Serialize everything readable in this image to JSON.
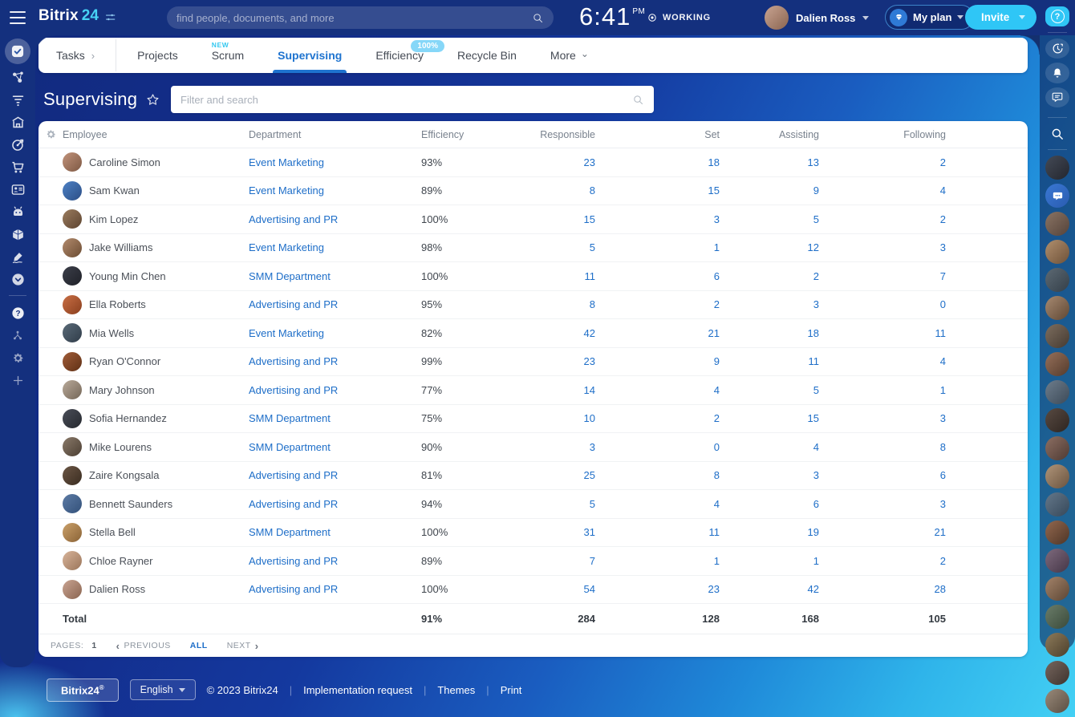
{
  "topbar": {
    "logo": {
      "brand": "Bitrix",
      "suffix": "24"
    },
    "search_placeholder": "find people, documents, and more",
    "time": {
      "value": "6:41",
      "meridiem": "PM"
    },
    "status_label": "WORKING",
    "user_name": "Dalien Ross",
    "my_plan_label": "My plan",
    "invite_label": "Invite"
  },
  "nav": {
    "tabs": [
      {
        "label": "Tasks",
        "trailing": "chevron-right",
        "active": false
      },
      {
        "label": "Projects",
        "active": false
      },
      {
        "label": "Scrum",
        "badge": "NEW",
        "badge_style": "text",
        "active": false
      },
      {
        "label": "Supervising",
        "active": true
      },
      {
        "label": "Efficiency",
        "badge": "100%",
        "badge_style": "pill",
        "active": false
      },
      {
        "label": "Recycle Bin",
        "active": false
      },
      {
        "label": "More",
        "trailing": "chevron-down",
        "active": false
      }
    ]
  },
  "page": {
    "title": "Supervising",
    "filter_placeholder": "Filter and search"
  },
  "table": {
    "columns": [
      "Employee",
      "Department",
      "Efficiency",
      "Responsible",
      "Set",
      "Assisting",
      "Following"
    ],
    "rows": [
      {
        "name": "Caroline Simon",
        "department": "Event Marketing",
        "efficiency": "93%",
        "responsible": "23",
        "set": "18",
        "assisting": "13",
        "following": "2",
        "avatar": [
          "#c2937b",
          "#7d5843"
        ]
      },
      {
        "name": "Sam Kwan",
        "department": "Event Marketing",
        "efficiency": "89%",
        "responsible": "8",
        "set": "15",
        "assisting": "9",
        "following": "4",
        "avatar": [
          "#4d80c4",
          "#2c4f86"
        ]
      },
      {
        "name": "Kim Lopez",
        "department": "Advertising and PR",
        "efficiency": "100%",
        "responsible": "15",
        "set": "3",
        "assisting": "5",
        "following": "2",
        "avatar": [
          "#9b7c5f",
          "#5d4430"
        ]
      },
      {
        "name": "Jake Williams",
        "department": "Event Marketing",
        "efficiency": "98%",
        "responsible": "5",
        "set": "1",
        "assisting": "12",
        "following": "3",
        "avatar": [
          "#b38b6d",
          "#6b4c33"
        ]
      },
      {
        "name": "Young Min Chen",
        "department": "SMM Department",
        "efficiency": "100%",
        "responsible": "11",
        "set": "6",
        "assisting": "2",
        "following": "7",
        "avatar": [
          "#3c3f4a",
          "#1f2128"
        ]
      },
      {
        "name": "Ella Roberts",
        "department": "Advertising and PR",
        "efficiency": "95%",
        "responsible": "8",
        "set": "2",
        "assisting": "3",
        "following": "0",
        "avatar": [
          "#c96f45",
          "#8a3f1e"
        ]
      },
      {
        "name": "Mia Wells",
        "department": "Event Marketing",
        "efficiency": "82%",
        "responsible": "42",
        "set": "21",
        "assisting": "18",
        "following": "11",
        "avatar": [
          "#5a6a78",
          "#303d49"
        ]
      },
      {
        "name": "Ryan O'Connor",
        "department": "Advertising and PR",
        "efficiency": "99%",
        "responsible": "23",
        "set": "9",
        "assisting": "11",
        "following": "4",
        "avatar": [
          "#a15c38",
          "#5f3015"
        ]
      },
      {
        "name": "Mary Johnson",
        "department": "Advertising and PR",
        "efficiency": "77%",
        "responsible": "14",
        "set": "4",
        "assisting": "5",
        "following": "1",
        "avatar": [
          "#b9aa9a",
          "#746657"
        ]
      },
      {
        "name": "Sofia Hernandez",
        "department": "SMM Department",
        "efficiency": "75%",
        "responsible": "10",
        "set": "2",
        "assisting": "15",
        "following": "3",
        "avatar": [
          "#4a4e58",
          "#26292f"
        ]
      },
      {
        "name": "Mike Lourens",
        "department": "SMM Department",
        "efficiency": "90%",
        "responsible": "3",
        "set": "0",
        "assisting": "4",
        "following": "8",
        "avatar": [
          "#8a7a6a",
          "#4c3f33"
        ]
      },
      {
        "name": "Zaire Kongsala",
        "department": "Advertising and PR",
        "efficiency": "81%",
        "responsible": "25",
        "set": "8",
        "assisting": "3",
        "following": "6",
        "avatar": [
          "#6b5645",
          "#3a2c20"
        ]
      },
      {
        "name": "Bennett Saunders",
        "department": "Advertising and PR",
        "efficiency": "94%",
        "responsible": "5",
        "set": "4",
        "assisting": "6",
        "following": "3",
        "avatar": [
          "#5d7ba5",
          "#33517a"
        ]
      },
      {
        "name": "Stella Bell",
        "department": "SMM Department",
        "efficiency": "100%",
        "responsible": "31",
        "set": "11",
        "assisting": "19",
        "following": "21",
        "avatar": [
          "#caa06a",
          "#8a6336"
        ]
      },
      {
        "name": "Chloe Rayner",
        "department": "Advertising and PR",
        "efficiency": "89%",
        "responsible": "7",
        "set": "1",
        "assisting": "1",
        "following": "2",
        "avatar": [
          "#d8b49a",
          "#9a755a"
        ]
      },
      {
        "name": "Dalien Ross",
        "department": "Advertising and PR",
        "efficiency": "100%",
        "responsible": "54",
        "set": "23",
        "assisting": "42",
        "following": "28",
        "avatar": [
          "#c9a492",
          "#8a6450"
        ]
      }
    ],
    "total": {
      "label": "Total",
      "efficiency": "91%",
      "responsible": "284",
      "set": "128",
      "assisting": "168",
      "following": "105"
    }
  },
  "pagination": {
    "pages_label": "PAGES:",
    "page": "1",
    "previous_label": "PREVIOUS",
    "all_label": "ALL",
    "next_label": "NEXT"
  },
  "footer": {
    "brand": "Bitrix24",
    "reg": "®",
    "language": "English",
    "copyright": "© 2023 Bitrix24",
    "links": [
      "Implementation request",
      "Themes",
      "Print"
    ]
  },
  "left_rail": {
    "items": [
      {
        "icon": "tasks",
        "active": true
      },
      {
        "icon": "network"
      },
      {
        "icon": "feed"
      },
      {
        "icon": "market"
      },
      {
        "icon": "crm"
      },
      {
        "icon": "cart"
      },
      {
        "icon": "employees"
      },
      {
        "icon": "copilot"
      },
      {
        "icon": "drive"
      },
      {
        "icon": "sign"
      },
      {
        "icon": "more"
      },
      {
        "icon": "help",
        "divider_before": true
      },
      {
        "icon": "structure",
        "dim": true
      },
      {
        "icon": "settings",
        "dim": true
      },
      {
        "icon": "add",
        "dim": true
      }
    ]
  },
  "right_rail": {
    "buttons": [
      {
        "icon": "help",
        "style": "cyan"
      },
      {
        "icon": "history",
        "style": "circle",
        "divider_before": true
      },
      {
        "icon": "bell",
        "style": "circle"
      },
      {
        "icon": "messenger",
        "style": "circle"
      },
      {
        "icon": "search",
        "style": "plain",
        "divider_before": true
      }
    ],
    "avatars": [
      {
        "type": "logo",
        "colors": [
          "#444a56",
          "#23262e"
        ],
        "divider_before": true
      },
      {
        "type": "icon-chat",
        "colors": [
          "#3a78d4",
          "#2a5cb0"
        ]
      },
      {
        "type": "photo",
        "colors": [
          "#8a7464",
          "#55433a"
        ]
      },
      {
        "type": "photo",
        "colors": [
          "#b08f6e",
          "#6e5138"
        ]
      },
      {
        "type": "photo",
        "colors": [
          "#5d6a74",
          "#343f49"
        ]
      },
      {
        "type": "photo",
        "colors": [
          "#a78a72",
          "#5f4733"
        ]
      },
      {
        "type": "photo",
        "colors": [
          "#7d6e5f",
          "#453a31"
        ]
      },
      {
        "type": "photo",
        "colors": [
          "#96705a",
          "#543b2c"
        ]
      },
      {
        "type": "photo",
        "colors": [
          "#6e7d8c",
          "#3c4a58"
        ]
      },
      {
        "type": "photo",
        "colors": [
          "#584a42",
          "#2e2520"
        ]
      },
      {
        "type": "photo",
        "colors": [
          "#8d6f63",
          "#4e3a33"
        ]
      },
      {
        "type": "photo",
        "colors": [
          "#b09579",
          "#6a533f"
        ]
      },
      {
        "type": "photo",
        "colors": [
          "#65788a",
          "#36485a"
        ]
      },
      {
        "type": "photo",
        "colors": [
          "#93684f",
          "#4e3526"
        ]
      },
      {
        "type": "photo",
        "colors": [
          "#7f6a7d",
          "#443647"
        ]
      },
      {
        "type": "photo",
        "colors": [
          "#a4836a",
          "#5c4634"
        ]
      },
      {
        "type": "photo",
        "colors": [
          "#6b7d6a",
          "#3a4a3a"
        ]
      },
      {
        "type": "photo",
        "colors": [
          "#8d7a5a",
          "#4c402c"
        ]
      },
      {
        "type": "photo",
        "colors": [
          "#76665e",
          "#3e332e"
        ]
      },
      {
        "type": "photo",
        "colors": [
          "#9a8a7a",
          "#5a4e42"
        ]
      }
    ]
  },
  "user_avatar_colors": [
    "#c9a492",
    "#8a6450"
  ],
  "colors": {
    "accent_cyan": "#2fc6f6",
    "link_blue": "#1e6ec8",
    "chrome_navy": "#14307e",
    "badge_light_blue": "#86d7f8"
  }
}
